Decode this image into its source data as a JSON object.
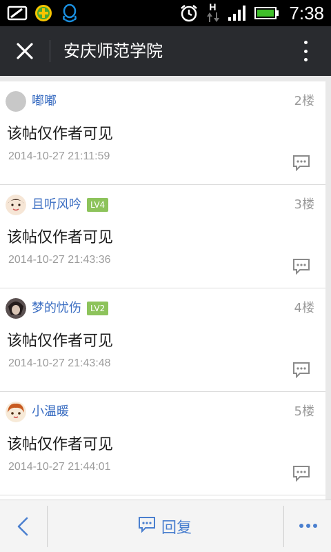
{
  "status_bar": {
    "time": "7:38",
    "network_label": "H",
    "icons": [
      "screen-icon",
      "app-plus-icon",
      "qq-icon",
      "alarm-icon",
      "network-arrows-icon",
      "signal-icon",
      "battery-icon"
    ]
  },
  "header": {
    "title": "安庆师范学院",
    "close_icon": "close-icon",
    "more_icon": "more-vertical-icon"
  },
  "posts": [
    {
      "name": "嘟嘟",
      "level": "",
      "floor": "2楼",
      "text": "该帖仅作者可见",
      "time": "2014-10-27 21:11:59"
    },
    {
      "name": "且听风吟",
      "level": "LV4",
      "floor": "3楼",
      "text": "该帖仅作者可见",
      "time": "2014-10-27 21:43:36"
    },
    {
      "name": "梦的忧伤",
      "level": "LV2",
      "floor": "4楼",
      "text": "该帖仅作者可见",
      "time": "2014-10-27 21:43:48"
    },
    {
      "name": "小温暖",
      "level": "",
      "floor": "5楼",
      "text": "该帖仅作者可见",
      "time": "2014-10-27 21:44:01"
    }
  ],
  "bottom_bar": {
    "reply_label": "回复",
    "back_icon": "back-arrow-icon",
    "more_icon": "more-horizontal-icon"
  },
  "colors": {
    "header_bg": "#292b2f",
    "username": "#3b6ec2",
    "level_badge": "#8dc35b",
    "accent": "#4a7fcf"
  }
}
